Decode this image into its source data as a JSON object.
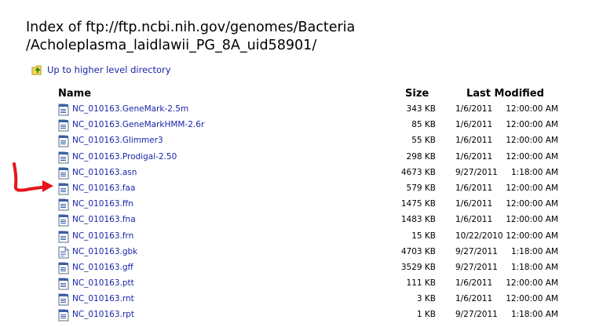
{
  "page": {
    "title_line1": "Index of ftp://ftp.ncbi.nih.gov/genomes/Bacteria",
    "title_line2": "/Acholeplasma_laidlawii_PG_8A_uid58901/",
    "up_link": "Up to higher level directory",
    "header": {
      "name": "Name",
      "size": "Size",
      "modified": "Last Modified"
    }
  },
  "files": [
    {
      "name": "NC_010163.GeneMark-2.5m",
      "size": "343 KB",
      "date": "1/6/2011",
      "time": "12:00:00 AM",
      "icon": "file-icon"
    },
    {
      "name": "NC_010163.GeneMarkHMM-2.6r",
      "size": "85 KB",
      "date": "1/6/2011",
      "time": "12:00:00 AM",
      "icon": "file-icon"
    },
    {
      "name": "NC_010163.Glimmer3",
      "size": "55 KB",
      "date": "1/6/2011",
      "time": "12:00:00 AM",
      "icon": "file-icon"
    },
    {
      "name": "NC_010163.Prodigal-2.50",
      "size": "298 KB",
      "date": "1/6/2011",
      "time": "12:00:00 AM",
      "icon": "file-icon"
    },
    {
      "name": "NC_010163.asn",
      "size": "4673 KB",
      "date": "9/27/2011",
      "time": "1:18:00 AM",
      "icon": "file-icon"
    },
    {
      "name": "NC_010163.faa",
      "size": "579 KB",
      "date": "1/6/2011",
      "time": "12:00:00 AM",
      "icon": "file-icon"
    },
    {
      "name": "NC_010163.ffn",
      "size": "1475 KB",
      "date": "1/6/2011",
      "time": "12:00:00 AM",
      "icon": "file-icon"
    },
    {
      "name": "NC_010163.fna",
      "size": "1483 KB",
      "date": "1/6/2011",
      "time": "12:00:00 AM",
      "icon": "file-icon"
    },
    {
      "name": "NC_010163.frn",
      "size": "15 KB",
      "date": "10/22/2010",
      "time": "12:00:00 AM",
      "icon": "file-icon"
    },
    {
      "name": "NC_010163.gbk",
      "size": "4703 KB",
      "date": "9/27/2011",
      "time": "1:18:00 AM",
      "icon": "document-icon"
    },
    {
      "name": "NC_010163.gff",
      "size": "3529 KB",
      "date": "9/27/2011",
      "time": "1:18:00 AM",
      "icon": "file-icon"
    },
    {
      "name": "NC_010163.ptt",
      "size": "111 KB",
      "date": "1/6/2011",
      "time": "12:00:00 AM",
      "icon": "file-icon"
    },
    {
      "name": "NC_010163.rnt",
      "size": "3 KB",
      "date": "1/6/2011",
      "time": "12:00:00 AM",
      "icon": "file-icon"
    },
    {
      "name": "NC_010163.rpt",
      "size": "1 KB",
      "date": "9/27/2011",
      "time": "1:18:00 AM",
      "icon": "file-icon"
    }
  ],
  "annotation": {
    "color": "#e8141c",
    "icon": "red-arrow-annotation"
  }
}
